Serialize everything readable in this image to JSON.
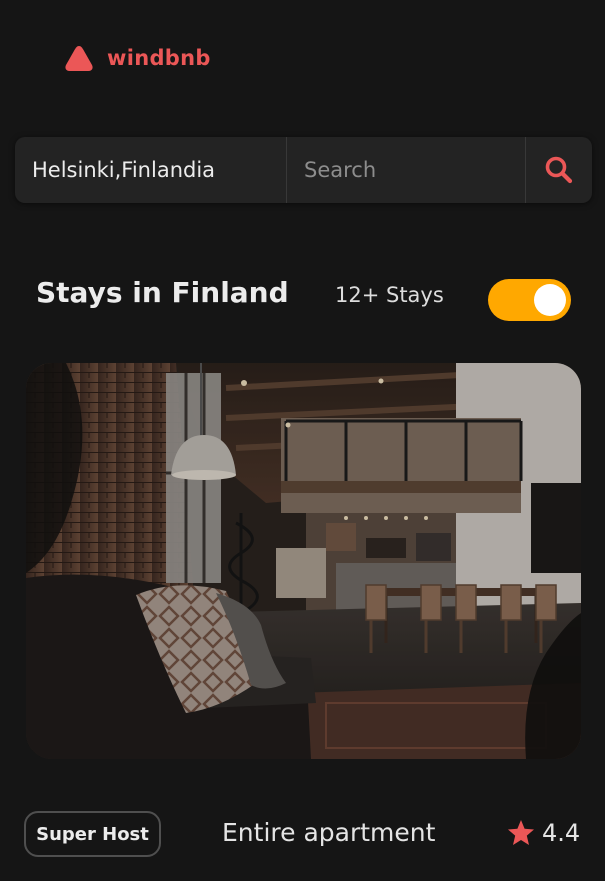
{
  "brand": {
    "name": "windbnb",
    "color": "#eb5757"
  },
  "search": {
    "location": "Helsinki,Finlandia",
    "guests_placeholder": "Search",
    "icon": "search-icon"
  },
  "results": {
    "title": "Stays in Finland",
    "count_label": "12+ Stays",
    "toggle_on": true,
    "toggle_color": "#ffa800"
  },
  "stay": {
    "image": "loft-apartment-photo",
    "super_host_label": "Super Host",
    "type": "Entire apartment",
    "rating": "4.4",
    "star_icon": "star-icon"
  }
}
